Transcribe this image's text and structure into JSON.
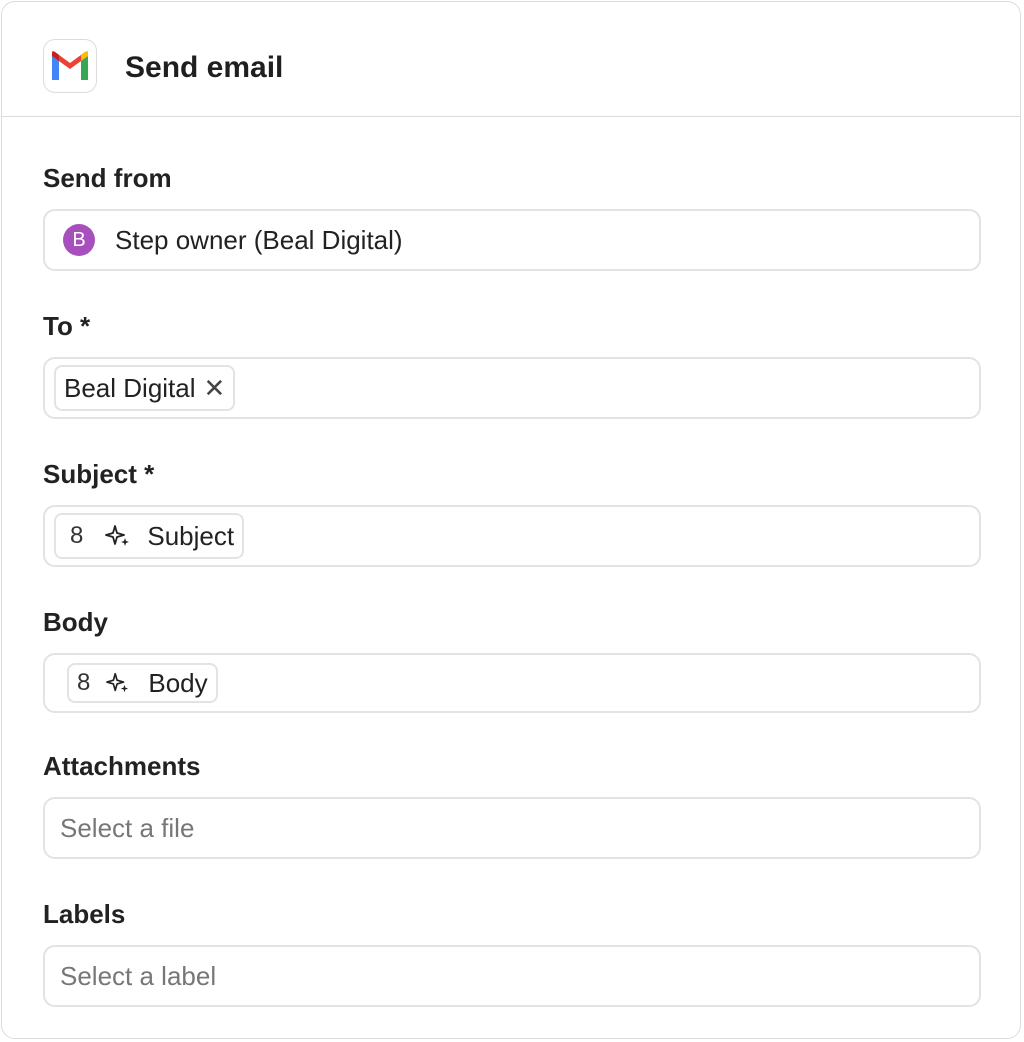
{
  "header": {
    "title": "Send email",
    "app_icon": "gmail-icon"
  },
  "send_from": {
    "label": "Send from",
    "avatar_letter": "B",
    "avatar_color": "#a64fbd",
    "value": "Step owner (Beal Digital)"
  },
  "to": {
    "label": "To *",
    "chip_label": "Beal Digital",
    "chip_remove_icon": "close-icon"
  },
  "subject": {
    "label": "Subject *",
    "chip_step": "8",
    "chip_icon": "sparkle-icon",
    "chip_label": "Subject"
  },
  "body": {
    "label": "Body",
    "chip_step": "8",
    "chip_icon": "sparkle-icon",
    "chip_label": "Body"
  },
  "attachments": {
    "label": "Attachments",
    "placeholder": "Select a file"
  },
  "labels": {
    "label": "Labels",
    "placeholder": "Select a label"
  }
}
